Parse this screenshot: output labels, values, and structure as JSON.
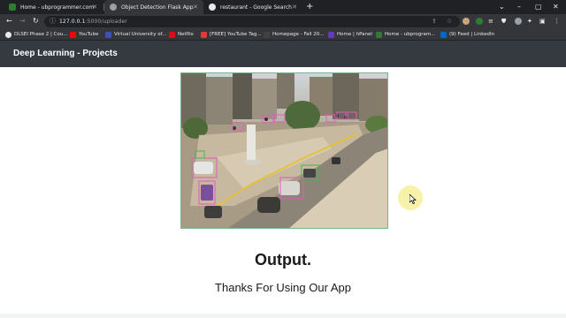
{
  "browser": {
    "tabs": [
      {
        "title": "Home - ubprogrammer.com",
        "active": false,
        "favicon_color": "#2e7d32"
      },
      {
        "title": "Object Detection Flask App",
        "active": true,
        "favicon_color": "#9aa0a6"
      },
      {
        "title": "restaurant - Google Search",
        "active": false,
        "favicon_color": "#e8eaed"
      }
    ],
    "url_host": "127.0.0.1",
    "url_rest": ":5000/uploader",
    "bookmarks": [
      {
        "label": "DLSEI Phase 2 | Cou...",
        "color": "#e8eaed"
      },
      {
        "label": "YouTube",
        "color": "#ff0000"
      },
      {
        "label": "Virtual University of...",
        "color": "#3f51b5"
      },
      {
        "label": "Netflix",
        "color": "#e50914"
      },
      {
        "label": "[FREE] YouTube Tag...",
        "color": "#e53935"
      },
      {
        "label": "Homepage - Fall 20...",
        "color": "#424242"
      },
      {
        "label": "Home | hPanel",
        "color": "#673ab7"
      },
      {
        "label": "Home - ubprogram...",
        "color": "#2e7d32"
      },
      {
        "label": "(9) Feed | LinkedIn",
        "color": "#0a66c2"
      }
    ]
  },
  "app": {
    "brand": "Deep Learning - Projects",
    "output_heading": "Output.",
    "thanks_message": "Thanks For Using Our App"
  },
  "colors": {
    "navbar": "#343a40",
    "detection_box_pink": "#e05cbf",
    "detection_box_green": "#4caf50"
  }
}
